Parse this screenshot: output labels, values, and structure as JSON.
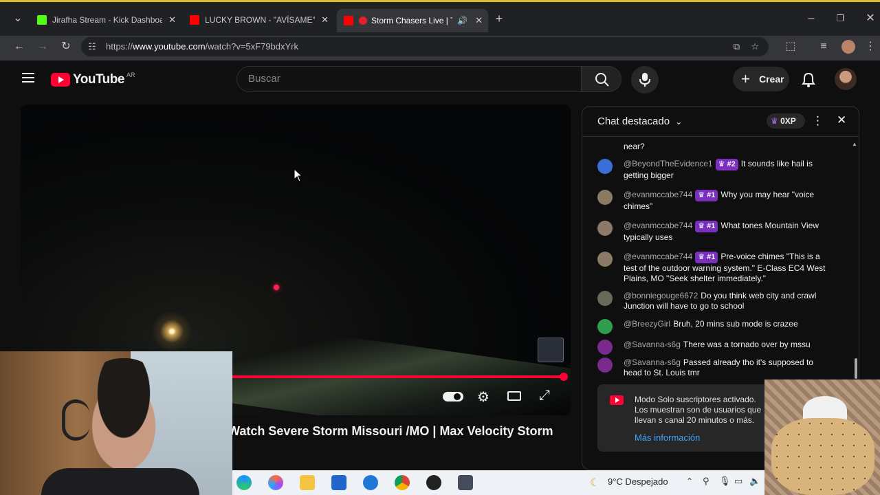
{
  "browser": {
    "tabs": [
      {
        "title": "Jirafha Stream - Kick Dashboard",
        "favicon_color": "#53fc18"
      },
      {
        "title": "LUCKY BROWN - \"AVÍSAME\" (V",
        "favicon_color": "#ff0000"
      },
      {
        "title": "Storm Chasers Live | Tor",
        "favicon_color": "#ff0000"
      }
    ],
    "url_prefix": "https://",
    "url_domain": "www.youtube.com",
    "url_path": "/watch?v=5xF79bdxYrk"
  },
  "youtube": {
    "logo_text": "YouTube",
    "country": "AR",
    "search_placeholder": "Buscar",
    "create_label": "Crear"
  },
  "video": {
    "title": "Watch Severe Storm Missouri /MO | Max Velocity Storm",
    "progress_percent": 100
  },
  "chat": {
    "header_title": "Chat destacado",
    "xp_label": "0XP",
    "top_fragment": "near?",
    "messages": [
      {
        "author": "@BeyondTheEvidence1",
        "badge": "#2",
        "text": "It sounds like hail is getting bigger",
        "avatar_color": "#3b6fd8"
      },
      {
        "author": "@evanmccabe744",
        "badge": "#1",
        "text": "Why you may hear \"voice chimes\"",
        "avatar_color": "#8a7a66"
      },
      {
        "author": "@evanmccabe744",
        "badge": "#1",
        "text": "What tones Mountain View typically uses",
        "avatar_color": "#8a7a66"
      },
      {
        "author": "@evanmccabe744",
        "badge": "#1",
        "text": "Pre-voice chimes \"This is a test of the outdoor warning system.\" E-Class EC4 West Plains, MO \"Seek shelter immediately.\"",
        "avatar_color": "#8a7a66"
      },
      {
        "author": "@bonniegouge6672",
        "badge": "",
        "text": "Do you think web city and crawl Junction will have to go to school",
        "avatar_color": "#6a6a5a"
      },
      {
        "author": "@BreezyGirl",
        "badge": "",
        "text": "Bruh, 20 mins sub mode is crazee",
        "avatar_color": "#2e9e4e"
      },
      {
        "author": "@Savanna-s6g",
        "badge": "",
        "text": "There was a tornado over by mssu",
        "avatar_color": "#7a2a8a"
      },
      {
        "author": "@Savanna-s6g",
        "badge": "",
        "text": "Passed already tho it's supposed to head to St. Louis tmr",
        "avatar_color": "#7a2a8a"
      }
    ],
    "notice_text": "Modo Solo suscriptores activado. Los muestran son de usuarios que llevan s canal 20 minutos o más.",
    "notice_link": "Más información"
  },
  "taskbar": {
    "weather": "9°C  Despejado"
  }
}
